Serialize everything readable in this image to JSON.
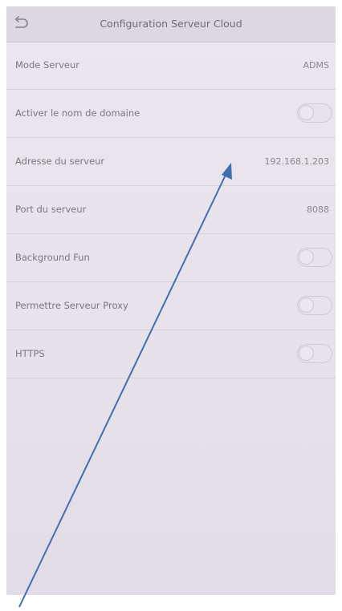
{
  "header": {
    "title": "Configuration Serveur Cloud",
    "back_icon": "back-arrow-icon"
  },
  "rows": [
    {
      "label": "Mode Serveur",
      "type": "value",
      "value": "ADMS"
    },
    {
      "label": "Activer le nom de domaine",
      "type": "toggle",
      "on": false
    },
    {
      "label": "Adresse du serveur",
      "type": "value",
      "value": "192.168.1.203"
    },
    {
      "label": "Port du serveur",
      "type": "value",
      "value": "8088"
    },
    {
      "label": "Background Fun",
      "type": "toggle",
      "on": false
    },
    {
      "label": "Permettre Serveur Proxy",
      "type": "toggle",
      "on": false
    },
    {
      "label": "HTTPS",
      "type": "toggle",
      "on": false
    }
  ],
  "annotation": {
    "icon": "blue-arrow-icon",
    "color": "#3f6fb3"
  },
  "colors": {
    "screen_background": "#e9e3ec",
    "header_background": "#ddd7e1",
    "text": "#7a7683"
  }
}
